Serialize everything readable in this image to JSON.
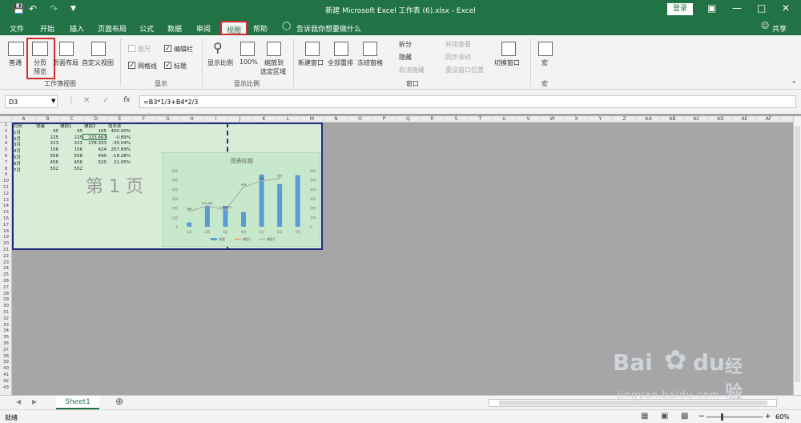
{
  "title": "新建 Microsoft Excel 工作表 (6).xlsx  -  Excel",
  "login": "登录",
  "share": "共享",
  "tabs": [
    "文件",
    "开始",
    "插入",
    "页面布局",
    "公式",
    "数据",
    "审阅",
    "视图",
    "帮助"
  ],
  "tell_me": "告诉我你想要做什么",
  "ribbon": {
    "normal": "普通",
    "page_break_1": "分页",
    "page_break_2": "预览",
    "page_layout": "页面布局",
    "custom_view": "自定义视图",
    "grp_views": "工作簿视图",
    "ruler": "直尺",
    "formula_bar": "编辑栏",
    "gridlines": "网格线",
    "headings": "标题",
    "grp_show": "显示",
    "zoom": "显示比例",
    "zoom100": "100%",
    "zoom_sel_1": "缩放到",
    "zoom_sel_2": "选定区域",
    "grp_zoom": "显示比例",
    "new_window": "新建窗口",
    "arrange_all": "全部重排",
    "freeze": "冻结窗格",
    "split": "拆分",
    "hide": "隐藏",
    "unhide": "取消隐藏",
    "side_by_side": "并排查看",
    "sync_scroll": "同步滚动",
    "reset_pos": "重设窗口位置",
    "switch_win": "切换窗口",
    "grp_window": "窗口",
    "macros": "宏",
    "grp_macros": "宏"
  },
  "namebox": "D3",
  "formula": "=B3*1/3+B4*2/3",
  "columns": [
    "A",
    "B",
    "C",
    "D",
    "E",
    "F",
    "G",
    "H",
    "I",
    "J",
    "K",
    "L",
    "M",
    "N",
    "O",
    "P",
    "Q",
    "R",
    "S",
    "T",
    "U",
    "V",
    "W",
    "X",
    "Y",
    "Z",
    "AA",
    "AB",
    "AC",
    "AD",
    "AE",
    "AF"
  ],
  "rows": [
    "1",
    "2",
    "3",
    "4",
    "5",
    "6",
    "7",
    "8",
    "9",
    "10",
    "11",
    "12",
    "13",
    "14",
    "15",
    "16",
    "17",
    "18",
    "19",
    "20",
    "21",
    "22",
    "23",
    "24",
    "25",
    "26",
    "27",
    "28",
    "29",
    "30",
    "31",
    "32",
    "33",
    "34",
    "35",
    "36",
    "37",
    "38",
    "39",
    "40",
    "41",
    "42",
    "43"
  ],
  "table": {
    "headers": [
      "月份",
      "销量",
      "辅助1",
      "辅助2",
      "增长率"
    ],
    "rows": [
      [
        "1月",
        "45",
        "45",
        "165",
        "400.00%"
      ],
      [
        "2月",
        "225",
        "225",
        "223.667",
        "-0.89%"
      ],
      [
        "3月",
        "223",
        "223",
        "178.333",
        "-30.04%"
      ],
      [
        "4月",
        "156",
        "156",
        "424",
        "257.69%"
      ],
      [
        "5月",
        "558",
        "558",
        "490",
        "-18.28%"
      ],
      [
        "6月",
        "456",
        "456",
        "520",
        "21.05%"
      ],
      [
        "7月",
        "552",
        "552",
        "",
        ""
      ]
    ]
  },
  "page_watermark": "第 1 页",
  "chart_data": {
    "type": "bar",
    "title": "图表标题",
    "categories": [
      "1月",
      "2月",
      "3月",
      "4月",
      "5月",
      "6月",
      "7月"
    ],
    "series": [
      {
        "name": "销量",
        "values": [
          45,
          225,
          223,
          156,
          558,
          456,
          552
        ]
      },
      {
        "name": "辅助1",
        "values": [
          45,
          225,
          223,
          156,
          558,
          456,
          552
        ]
      },
      {
        "name": "辅助2",
        "values": [
          165,
          223.667,
          178.333,
          424,
          490,
          520,
          null
        ]
      }
    ],
    "ylim": [
      0,
      600
    ],
    "yticks": [
      "0",
      "100",
      "200",
      "300",
      "400",
      "500",
      "600"
    ],
    "y2ticks": [
      "0",
      "100",
      "200",
      "300",
      "400",
      "500",
      "600"
    ],
    "legend": "bottom"
  },
  "sheet_tab": "Sheet1",
  "status": "就绪",
  "zoom_level": "60%"
}
